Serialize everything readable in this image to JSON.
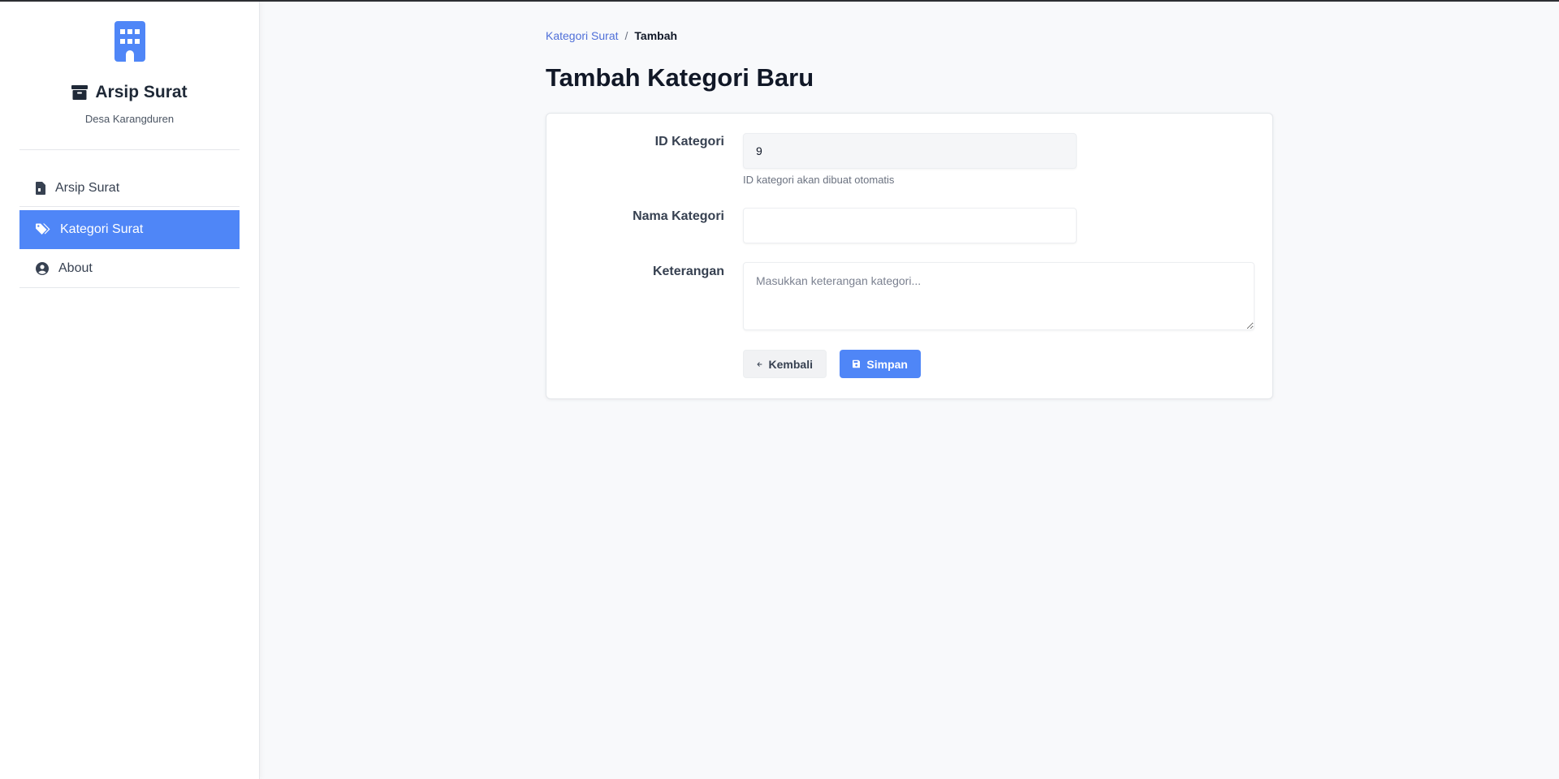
{
  "colors": {
    "accent": "#4f86f7",
    "sidebar_bg": "#ffffff",
    "page_bg": "#f8f9fb",
    "link": "#4f6fd8"
  },
  "sidebar": {
    "logo_icon": "building-icon",
    "title_icon": "archive-box-icon",
    "title": "Arsip Surat",
    "subtitle": "Desa Karangduren",
    "items": [
      {
        "label": "Arsip Surat",
        "icon": "file-icon",
        "active": false
      },
      {
        "label": "Kategori Surat",
        "icon": "tags-icon",
        "active": true
      },
      {
        "label": "About",
        "icon": "user-circle-icon",
        "active": false
      }
    ]
  },
  "breadcrumb": {
    "parent": "Kategori Surat",
    "separator": "/",
    "current": "Tambah"
  },
  "page": {
    "title": "Tambah Kategori Baru"
  },
  "form": {
    "id_field": {
      "label": "ID Kategori",
      "value": "9",
      "help": "ID kategori akan dibuat otomatis"
    },
    "name_field": {
      "label": "Nama Kategori",
      "value": "",
      "placeholder": ""
    },
    "desc_field": {
      "label": "Keterangan",
      "value": "",
      "placeholder": "Masukkan keterangan kategori..."
    },
    "back_button": {
      "label": "Kembali",
      "icon": "arrow-left-icon"
    },
    "save_button": {
      "label": "Simpan",
      "icon": "floppy-disk-icon"
    }
  }
}
